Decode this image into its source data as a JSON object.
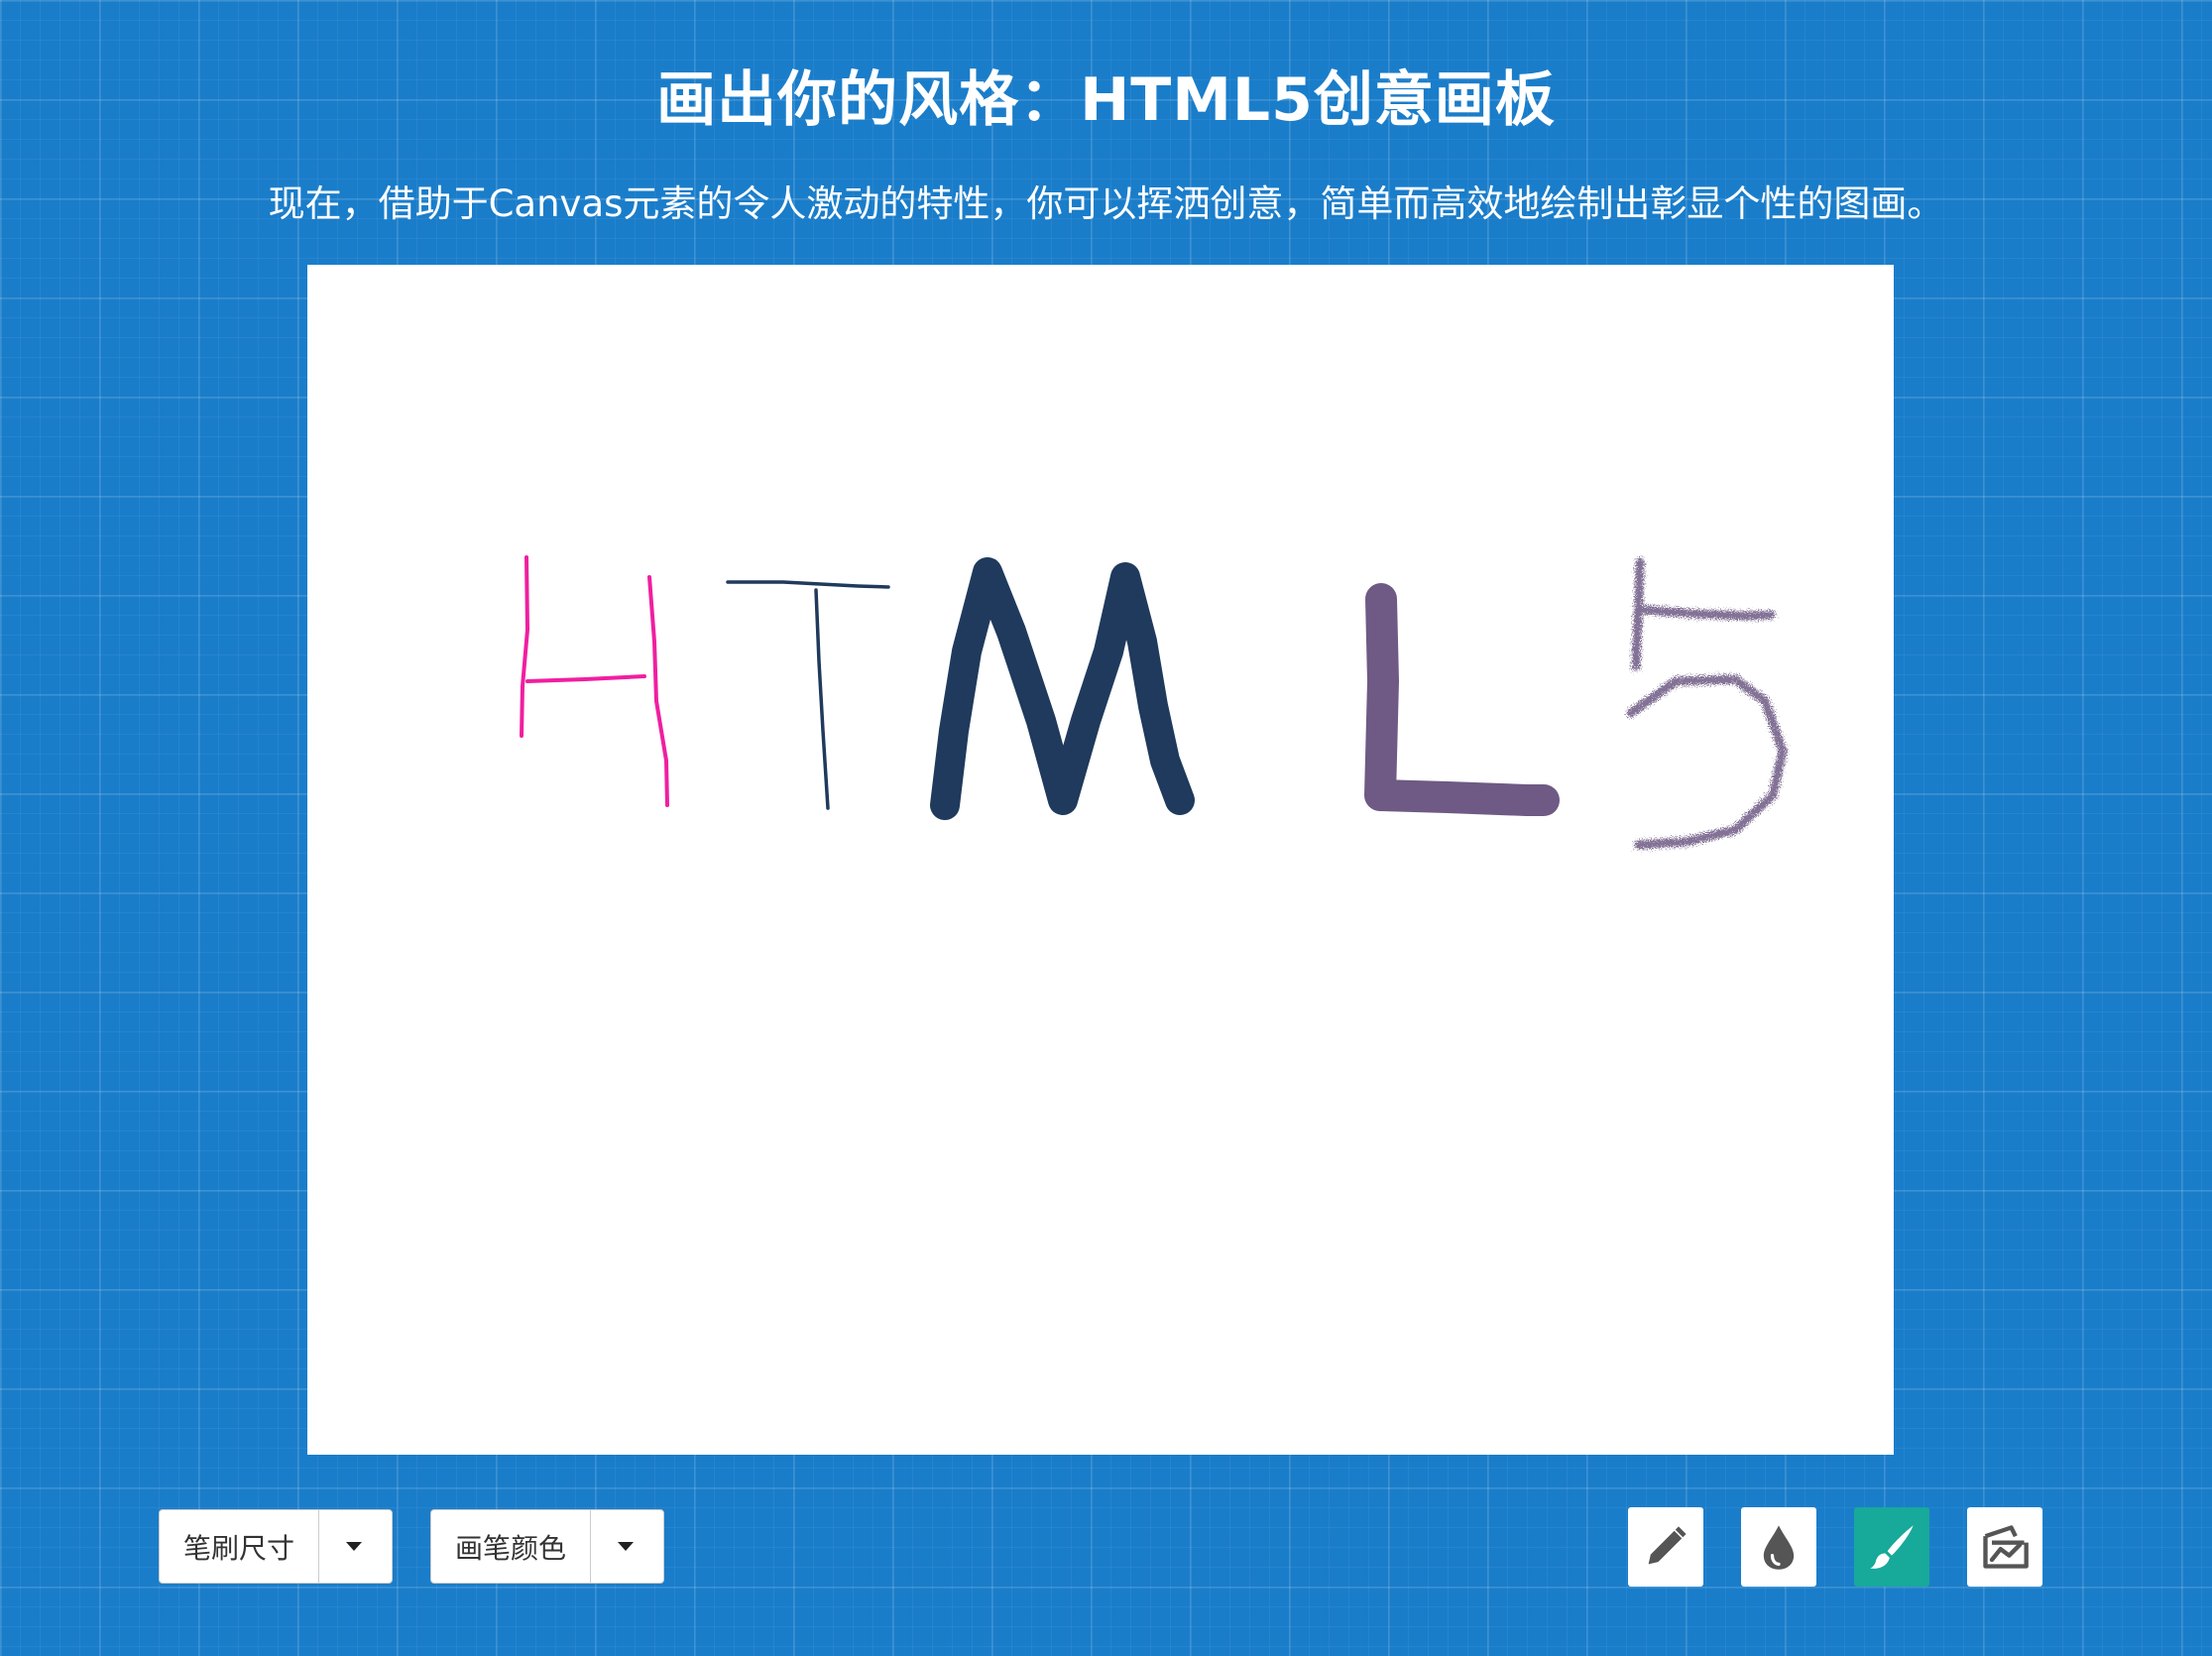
{
  "header": {
    "title": "画出你的风格：HTML5创意画板",
    "subtitle": "现在，借助于Canvas元素的令人激动的特性，你可以挥洒创意，简单而高效地绘制出彰显个性的图画。"
  },
  "canvas": {
    "background": "#ffffff",
    "strokes": [
      {
        "letter": "H",
        "color": "#f01fa0",
        "brush": "pencil"
      },
      {
        "letter": "T",
        "color": "#1f3a5c",
        "brush": "pencil"
      },
      {
        "letter": "M",
        "color": "#1f3a5c",
        "brush": "marker"
      },
      {
        "letter": "L",
        "color": "#6e5a84",
        "brush": "marker"
      },
      {
        "letter": "5",
        "color": "#6e5a84",
        "brush": "spray"
      }
    ]
  },
  "toolbar": {
    "brush_size_label": "笔刷尺寸",
    "brush_color_label": "画笔颜色",
    "tools": [
      {
        "name": "pencil",
        "icon": "pencil-icon",
        "active": false
      },
      {
        "name": "ink",
        "icon": "ink-drop-icon",
        "active": false
      },
      {
        "name": "brush",
        "icon": "paintbrush-icon",
        "active": true
      },
      {
        "name": "spray",
        "icon": "spray-icon",
        "active": false
      }
    ]
  },
  "colors": {
    "background": "#1a7dca",
    "active_tool": "#17a99a",
    "icon_gray": "#555555"
  }
}
